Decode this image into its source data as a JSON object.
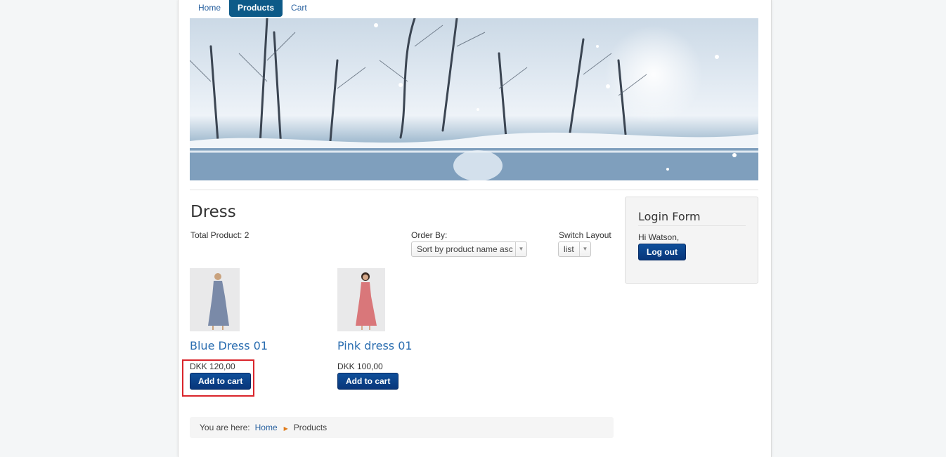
{
  "nav": {
    "items": [
      "Home",
      "Products",
      "Cart"
    ],
    "active": "Products"
  },
  "main": {
    "title": "Dress",
    "total_label": "Total Product: 2",
    "order_by_label": "Order By:",
    "order_by_value": "Sort by product name asc",
    "switch_layout_label": "Switch Layout",
    "switch_layout_value": "list"
  },
  "products": [
    {
      "name": "Blue Dress 01",
      "price": "DKK 120,00",
      "button": "Add to cart",
      "dress_color": "#7a8aa8"
    },
    {
      "name": "Pink dress 01",
      "price": "DKK 100,00",
      "button": "Add to cart",
      "dress_color": "#d9777a"
    }
  ],
  "login": {
    "title": "Login Form",
    "greeting": "Hi Watson,",
    "button": "Log out"
  },
  "breadcrumb": {
    "prefix": "You are here:",
    "home": "Home",
    "current": "Products"
  },
  "colors": {
    "accent": "#0d5a88",
    "button": "#08367a",
    "highlight": "#d9252b",
    "link": "#2a62a0"
  }
}
